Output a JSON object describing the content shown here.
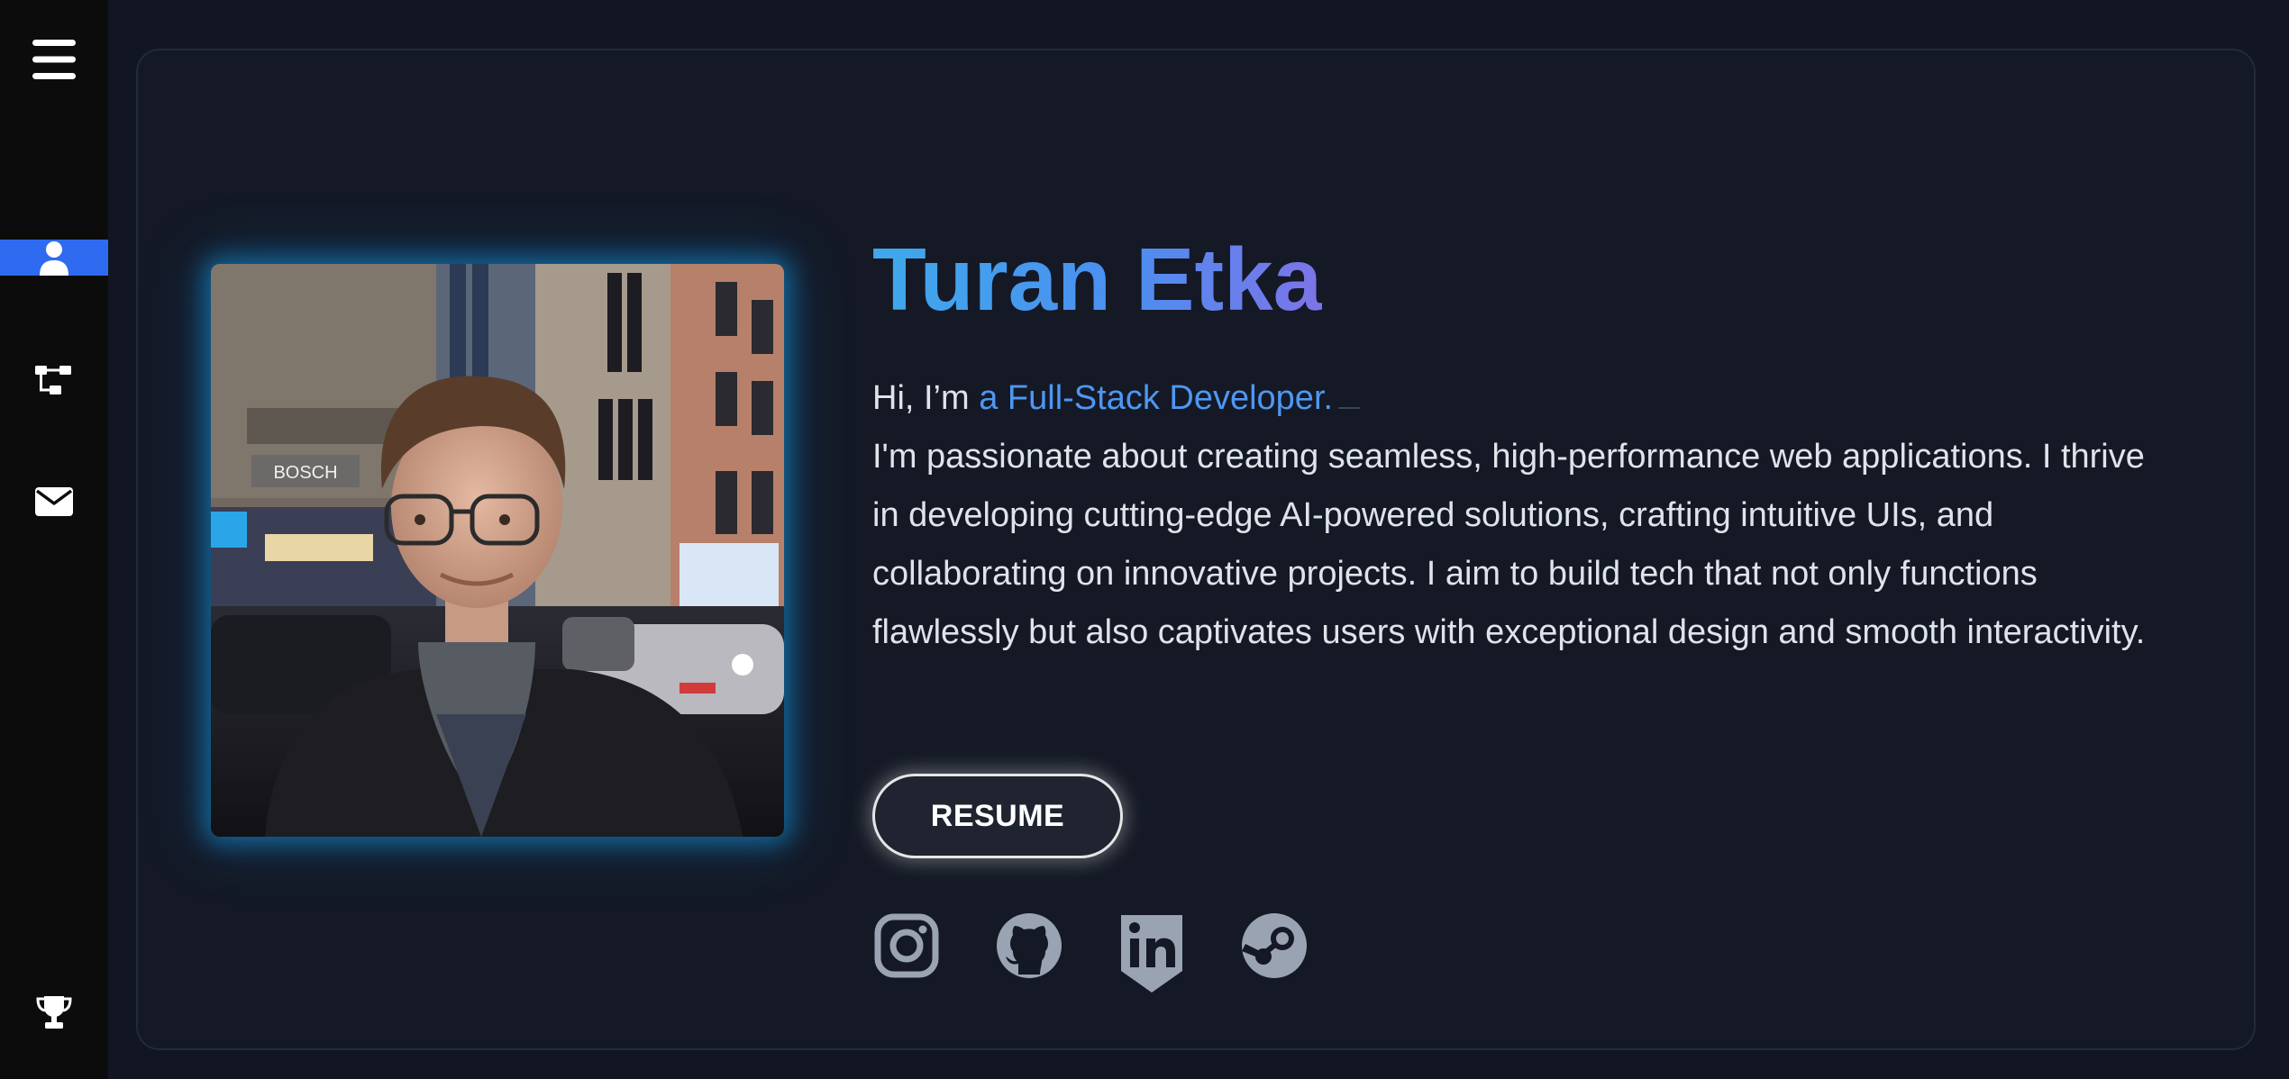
{
  "sidebar": {
    "items": [
      {
        "icon": "menu-icon"
      },
      {
        "icon": "user-icon",
        "active": true
      },
      {
        "icon": "sitemap-icon"
      },
      {
        "icon": "envelope-icon"
      },
      {
        "icon": "trophy-icon"
      }
    ],
    "active_color": "#2f6bf0"
  },
  "profile": {
    "name": "Turan Etka",
    "greeting": "Hi, I’m ",
    "role": "a Full-Stack Developer.",
    "bio": "I'm passionate about creating seamless, high-performance web applications. I thrive in developing cutting-edge AI-powered solutions, crafting intuitive UIs, and collaborating on innovative projects. I aim to build tech that not only functions flawlessly but also captivates users with exceptional design and smooth interactivity.",
    "resume_label": "RESUME",
    "name_gradient": [
      "#3fa9ea",
      "#7d74e8"
    ],
    "role_color": "#4e97f3",
    "photo_sign_text": "BOSCH"
  },
  "socials": [
    {
      "icon": "instagram-icon"
    },
    {
      "icon": "github-icon"
    },
    {
      "icon": "linkedin-icon"
    },
    {
      "icon": "steam-icon"
    }
  ]
}
